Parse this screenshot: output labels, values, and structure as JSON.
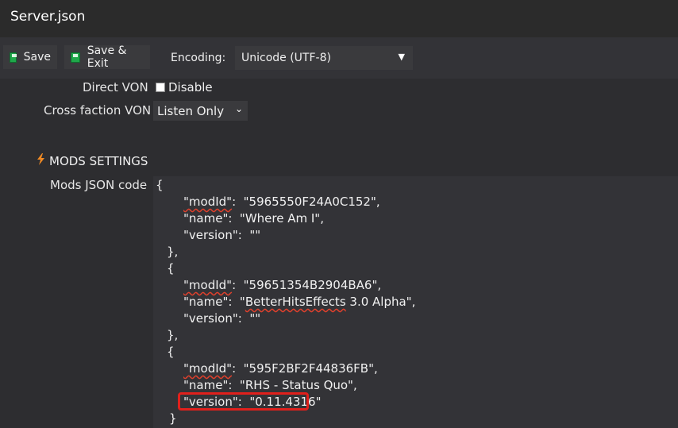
{
  "window": {
    "title": "Server.json"
  },
  "toolbar": {
    "save_label": "Save",
    "save_exit_label": "Save & Exit",
    "encoding_label": "Encoding:",
    "encoding_value": "Unicode (UTF-8)",
    "dropdown_arrow": "▼"
  },
  "form": {
    "direct_von_label": "Direct VON",
    "direct_von_checkbox_label": "Disable",
    "cross_faction_label": "Cross faction VON",
    "cross_faction_value": "Listen Only",
    "select_arrow": "⌄"
  },
  "mods_section": {
    "icon": "bolt-icon",
    "title": "MODS SETTINGS",
    "json_label": "Mods JSON code"
  },
  "json_lines": [
    "{",
    "\"modId\":  \"5965550F24A0C152\",",
    "\"name\":  \"Where Am I\",",
    "\"version\":  \"\"",
    "},",
    "{",
    "\"modId\":  \"59651354B2904BA6\",",
    "\"name\":  \"BetterHitsEffects 3.0 Alpha\",",
    "\"version\":  \"\"",
    "},",
    "{",
    "\"modId\":  \"595F2BF2F44836FB\",",
    "\"name\":  \"RHS - Status Quo\",",
    "\"version\":  \"0.11.4316\"",
    "}"
  ],
  "colors": {
    "background": "#2d2d30",
    "save_icon": "#1fa84a",
    "bolt_icon": "#f08a24",
    "highlight": "#e0201c",
    "spellcheck": "#e0402c"
  }
}
